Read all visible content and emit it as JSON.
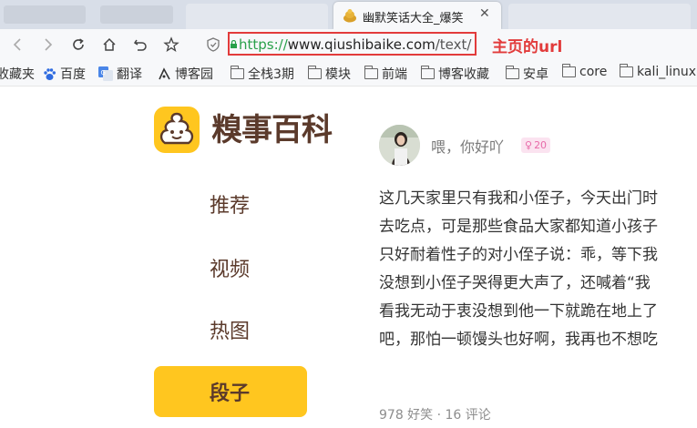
{
  "browser": {
    "active_tab_title": "幽默笑话大全_爆笑",
    "url_scheme": "https://",
    "url_host": "www.qiushibaike.com",
    "url_path": "/text/",
    "annotation": "主页的url"
  },
  "bookmarks": [
    {
      "label": "收藏夹",
      "icon": "none"
    },
    {
      "label": "百度",
      "icon": "baidu-icon"
    },
    {
      "label": "翻译",
      "icon": "google-translate-icon"
    },
    {
      "label": "博客园",
      "icon": "cnblogs-icon"
    },
    {
      "label": "全栈3期",
      "icon": "folder-icon"
    },
    {
      "label": "模块",
      "icon": "folder-icon"
    },
    {
      "label": "前端",
      "icon": "folder-icon"
    },
    {
      "label": "博客收藏",
      "icon": "folder-icon"
    },
    {
      "label": "安卓",
      "icon": "folder-icon"
    },
    {
      "label": "core",
      "icon": "folder-icon"
    },
    {
      "label": "kali_linux",
      "icon": "folder-icon"
    }
  ],
  "site": {
    "logo_text": "糗事百科",
    "nav": [
      "推荐",
      "视频",
      "热图",
      "段子"
    ],
    "active_nav": "段子"
  },
  "post": {
    "author": "喂，你好吖",
    "badge_count": "20",
    "lines": [
      "这几天家里只有我和小侄子，今天出门时",
      "去吃点，可是那些食品大家都知道小孩子",
      "只好耐着性子的对小侄子说：乖，等下我",
      "没想到小侄子哭得更大声了，还喊着“我",
      "看我无动于衷没想到他一下就跪在地上了",
      "吧，那怕一顿馒头也好啊，我再也不想吃"
    ],
    "stats": "978 好笑 · 16 评论"
  },
  "colors": {
    "brand_yellow": "#ffc61f",
    "brand_brown": "#5b3a2b",
    "annotation_red": "#e23b3b"
  }
}
